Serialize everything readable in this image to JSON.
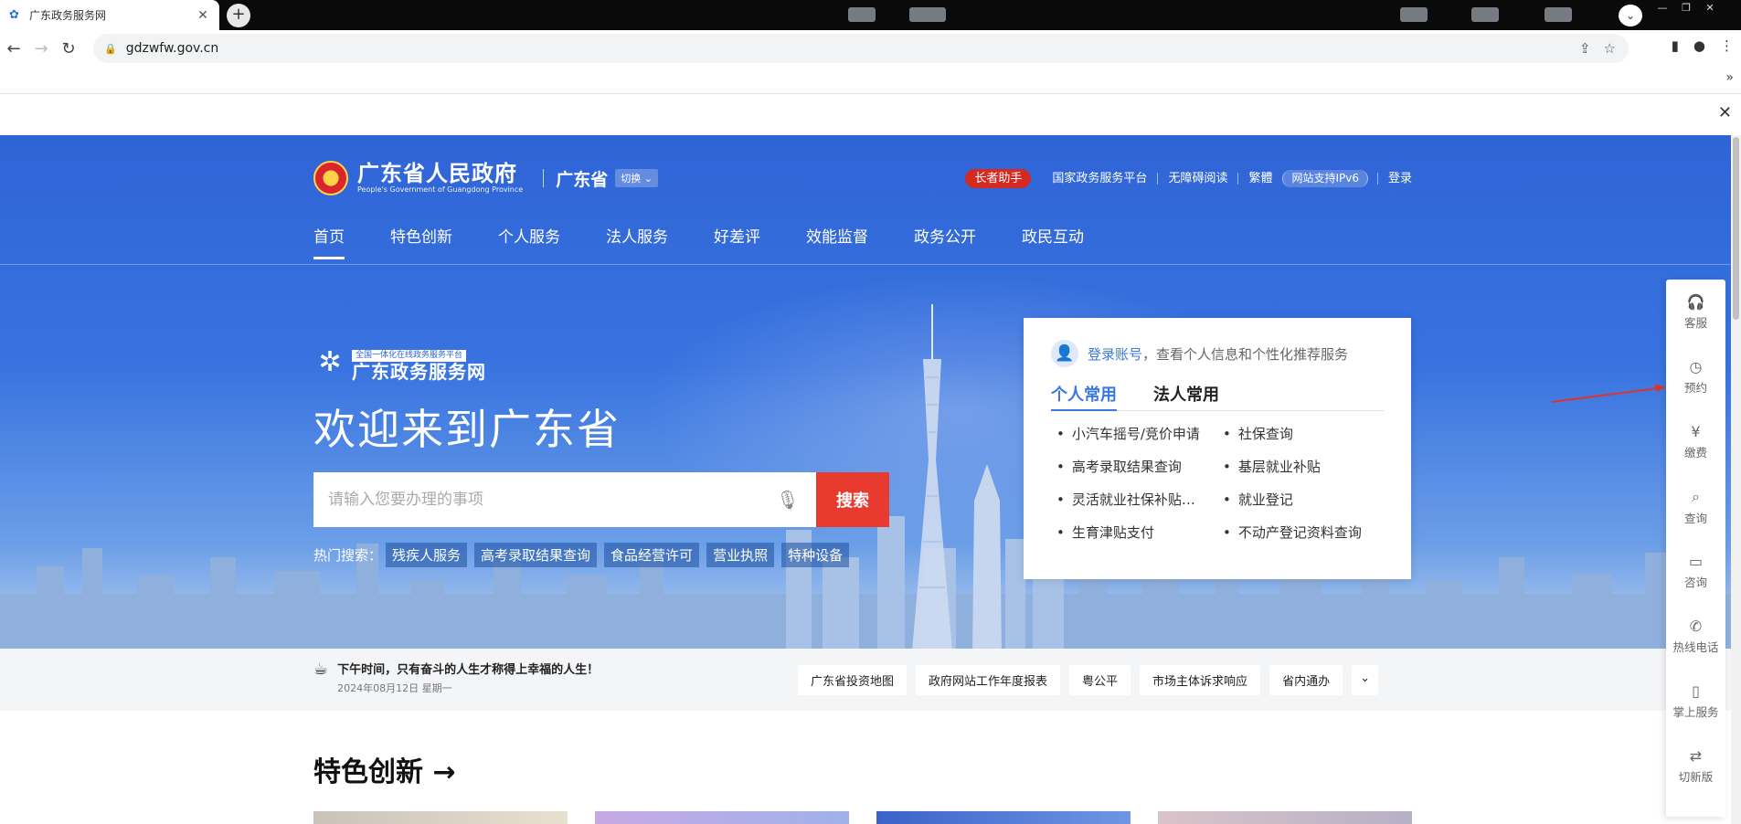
{
  "browser": {
    "tab_title": "广东政务服务网",
    "url": "gdzwfw.gov.cn"
  },
  "header": {
    "gov_name": "广东省人民政府",
    "gov_name_en": "People's Government of Guangdong Province",
    "region": "广东省",
    "switch_label": "切换",
    "links": {
      "elder": "长者助手",
      "national": "国家政务服务平台",
      "accessible": "无障碍阅读",
      "traditional": "繁體",
      "ipv6": "网站支持IPv6",
      "login": "登录"
    }
  },
  "nav": [
    "首页",
    "特色创新",
    "个人服务",
    "法人服务",
    "好差评",
    "效能监督",
    "政务公开",
    "政民互动"
  ],
  "hero": {
    "platform_tag": "全国一体化在线政务服务平台",
    "platform_name": "广东政务服务网",
    "welcome": "欢迎来到广东省",
    "search_placeholder": "请输入您要办理的事项",
    "search_button": "搜索",
    "hot_label": "热门搜索：",
    "hot_items": [
      "残疾人服务",
      "高考录取结果查询",
      "食品经营许可",
      "营业执照",
      "特种设备"
    ]
  },
  "card": {
    "login_link": "登录账号",
    "login_text": "，查看个人信息和个性化推荐服务",
    "tabs": [
      "个人常用",
      "法人常用"
    ],
    "services": [
      "小汽车摇号/竞价申请",
      "社保查询",
      "高考录取结果查询",
      "基层就业补贴",
      "灵活就业社保补贴申领",
      "就业登记",
      "生育津贴支付",
      "不动产登记资料查询"
    ]
  },
  "strip": {
    "greeting": "下午时间，只有奋斗的人生才称得上幸福的人生！",
    "date": "2024年08月12日 星期一",
    "quick_links": [
      "广东省投资地图",
      "政府网站工作年度报表",
      "粤公平",
      "市场主体诉求响应",
      "省内通办"
    ]
  },
  "section": {
    "title": "特色创新",
    "arrow": "→"
  },
  "float_bar": [
    "客服",
    "预约",
    "缴费",
    "查询",
    "咨询",
    "热线电话",
    "掌上服务",
    "切新版"
  ],
  "colors": {
    "primary": "#2f64d6",
    "accent_red": "#e83a2f",
    "link_blue": "#3a78e0"
  }
}
